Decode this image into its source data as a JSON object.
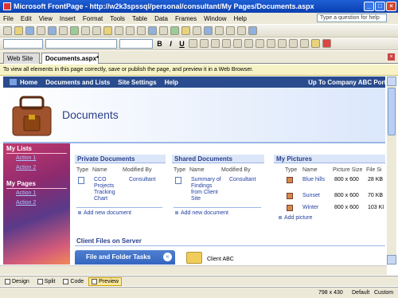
{
  "window": {
    "title": "Microsoft FrontPage - http://w2k3spssql/personal/consultant/My Pages/Documents.aspx"
  },
  "menu": {
    "items": [
      "File",
      "Edit",
      "View",
      "Insert",
      "Format",
      "Tools",
      "Table",
      "Data",
      "Frames",
      "Window",
      "Help"
    ],
    "help_placeholder": "Type a question for help"
  },
  "tabs": {
    "site": "Web Site",
    "doc": "Documents.aspx*"
  },
  "infobar": {
    "text": "To view all elements in this page correctly, save or publish the page, and preview it in a Web Browser."
  },
  "nav": {
    "links": [
      "Home",
      "Documents and Lists",
      "Site Settings",
      "Help"
    ],
    "up_link": "Up To Company ABC Portal"
  },
  "page_title": "Documents",
  "quicklaunch": {
    "my_lists": "My Lists",
    "lists": [
      "Action 1",
      "Action 2"
    ],
    "my_pages": "My Pages",
    "pages": [
      "Action 1",
      "Action 2"
    ]
  },
  "private_docs": {
    "title": "Private Documents",
    "col_type": "Type",
    "col_name": "Name",
    "col_modified": "Modified By",
    "row_name": "CCO Projects Tracking Chart",
    "row_modified": "Consultant",
    "add": "Add new document"
  },
  "shared_docs": {
    "title": "Shared Documents",
    "col_type": "Type",
    "col_name": "Name",
    "col_modified": "Modified By",
    "row_name": "Summary of Findings from Client Site",
    "row_modified": "Consultant",
    "add": "Add new document"
  },
  "my_pictures": {
    "title": "My Pictures",
    "col_type": "Type",
    "col_name": "Name",
    "col_size": "Picture Size",
    "col_file": "File Si",
    "rows": [
      {
        "name": "Blue hills",
        "size": "800 x 600",
        "file": "28 KB"
      },
      {
        "name": "Sunset",
        "size": "800 x 600",
        "file": "70 KB"
      },
      {
        "name": "Winter",
        "size": "800 x 600",
        "file": "103 KI"
      }
    ],
    "add": "Add picture"
  },
  "client_files": {
    "title": "Client Files on Server",
    "tasks": "File and Folder Tasks",
    "folder": "Client ABC"
  },
  "viewtabs": {
    "design": "Design",
    "split": "Split",
    "code": "Code",
    "preview": "Preview"
  },
  "status": {
    "dims": "798 x 430",
    "mode": "Default",
    "custom": "Custom"
  }
}
